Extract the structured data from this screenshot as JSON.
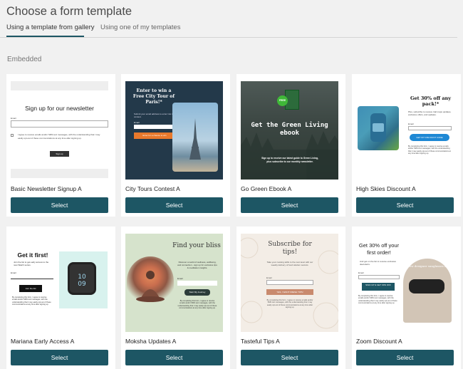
{
  "page": {
    "title": "Choose a form template",
    "tabs": [
      {
        "label": "Using a template from gallery",
        "active": true
      },
      {
        "label": "Using one of my templates",
        "active": false
      }
    ],
    "section": "Embedded",
    "accent_color": "#1d5664"
  },
  "cards": [
    {
      "name": "Basic Newsletter Signup A",
      "select_label": "Select",
      "preview": {
        "heading": "Sign up for our newsletter",
        "email_label": "Email",
        "consent": "I agree to receive emails and/or SMS text messages, with the understanding that I may easily opt-out of these communications at any time after signing up.",
        "button": "Sign up"
      }
    },
    {
      "name": "City Tours Contest A",
      "select_label": "Select",
      "preview": {
        "heading": "Enter to win a Free City Tour of Paris!*",
        "subtext": "Submit your email address to enter into the contest.",
        "email_label": "Email",
        "button": "Enter for a chance to win"
      }
    },
    {
      "name": "Go Green Ebook A",
      "select_label": "Select",
      "preview": {
        "badge": "FREE",
        "heading": "Get the Green Living ebook",
        "subtext": "Sign up to receive our latest guide to Green Living, plus subscribe to our monthly newsletter."
      }
    },
    {
      "name": "High Skies Discount A",
      "select_label": "Select",
      "preview": {
        "heading": "Get 30% off any pack!*",
        "subtext": "Plus, subscribe to receive trail maps updates, exclusive offers, and updates.",
        "email_label": "Email",
        "button": "GET MY DISCOUNT CODE",
        "fine_print": "By completing this form, I agree to receive emails and/or SMS text messages, with the understanding that I may easily opt-out of these communications at any time after signing up."
      }
    },
    {
      "name": "Mariana Early Access A",
      "select_label": "Select",
      "preview": {
        "heading": "Get it first!",
        "subtext": "Join the list to get early access to the new Watch series.",
        "email_label": "Email",
        "button": "Join the list",
        "fine_print": "By completing this form, I agree to receive emails and/or SMS text messages, with the understanding that I may easily opt-out of these communications at any time after signing up."
      }
    },
    {
      "name": "Moksha Updates A",
      "select_label": "Select",
      "preview": {
        "heading": "Find your bliss",
        "subtext": "Discover a world of wellness, wellbeing, and connection - sign up for exclusive tips & meditation insights.",
        "email_label": "Email",
        "button": "Start My Journey",
        "fine_print": "By completing this form, I agree to receive emails and/or SMS text messages, with the understanding that I may easily opt-out of these communications at any time after signing up."
      }
    },
    {
      "name": "Tasteful Tips A",
      "select_label": "Select",
      "preview": {
        "heading": "Subscribe for tips!",
        "subtext": "Take your cooking skills to the next level with our weekly delivery of food wisdom secrets.",
        "email_label": "Email",
        "button": "YES, I WANT FRESH TIPS!",
        "fine_print": "By completing this form, I agree to receive emails and/or SMS text messages, with the understanding that I may easily opt-out of these communications at any time after signing up."
      }
    },
    {
      "name": "Zoom Discount A",
      "select_label": "Select",
      "preview": {
        "heading": "Get 30% off your first order!",
        "subtext": "And get on the list to receive exclusive deal alerts.",
        "email_label": "Email",
        "button": "SIGN UP & GET 30% OFF",
        "fine_print": "By completing this form, I agree to receive emails and/or SMS text messages, with the understanding that I may easily opt-out of these communications at any time after signing up.",
        "image_text": "new designer sunglasses in"
      }
    }
  ]
}
